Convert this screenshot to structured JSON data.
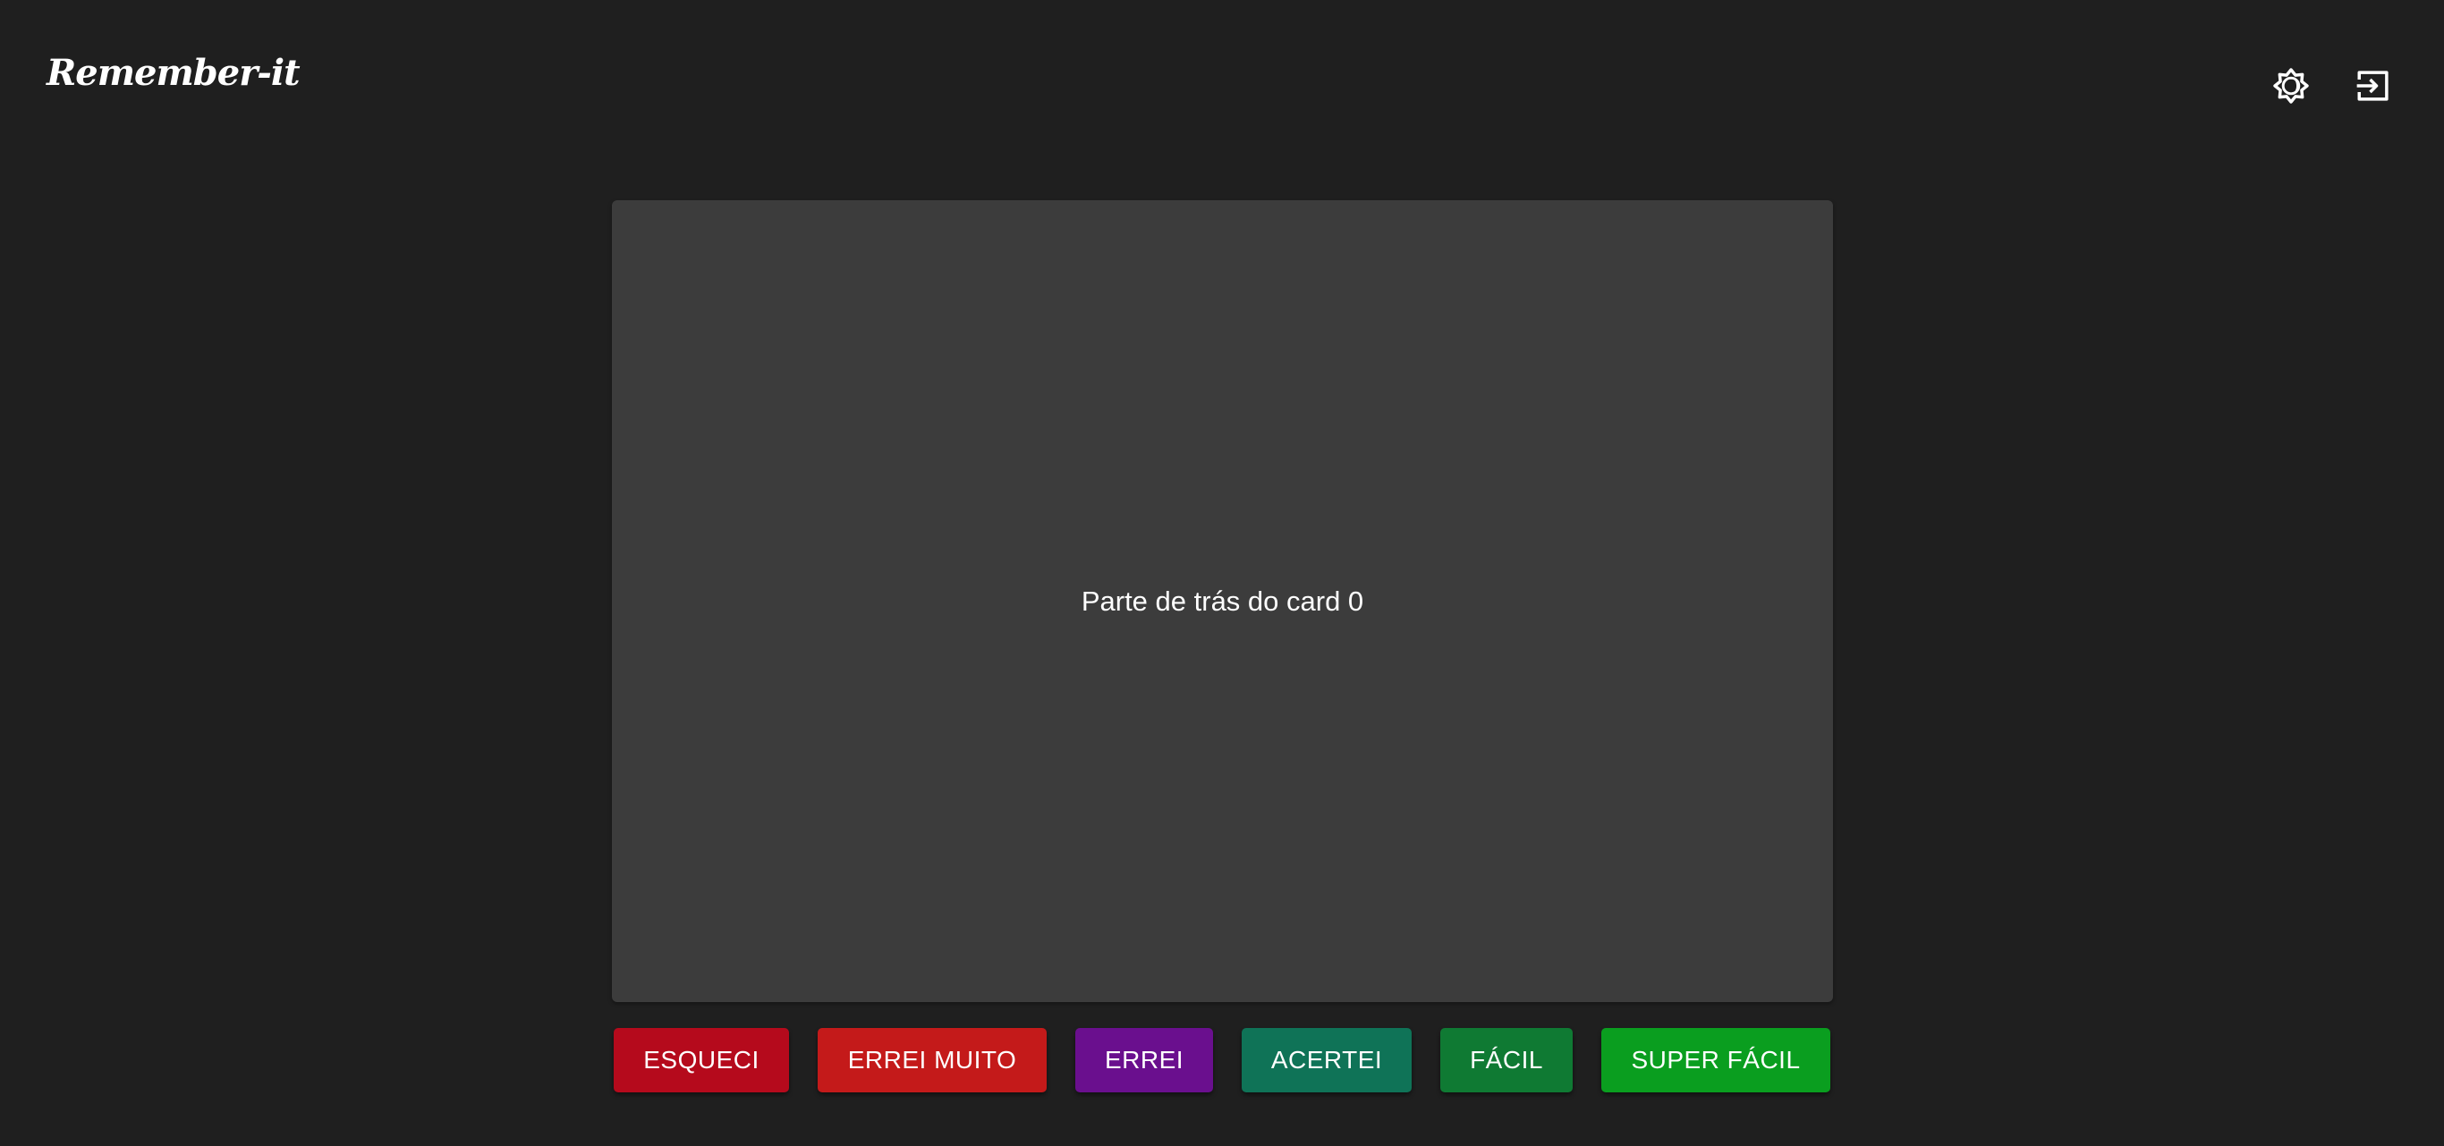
{
  "header": {
    "logo": "Remember-it",
    "theme_icon": "brightness-icon",
    "logout_icon": "logout-icon"
  },
  "card": {
    "text": "Parte de trás do card 0"
  },
  "buttons": [
    {
      "label": "ESQUECI",
      "color": "#b50a1c"
    },
    {
      "label": "ERREI MUITO",
      "color": "#c41a1a"
    },
    {
      "label": "ERREI",
      "color": "#6a0f8e"
    },
    {
      "label": "ACERTEI",
      "color": "#0f7357"
    },
    {
      "label": "FÁCIL",
      "color": "#0f7a33"
    },
    {
      "label": "SUPER FÁCIL",
      "color": "#0a9e1f"
    }
  ],
  "colors": {
    "background": "#1f1f1f",
    "card": "#3c3c3c",
    "text": "#ffffff"
  }
}
